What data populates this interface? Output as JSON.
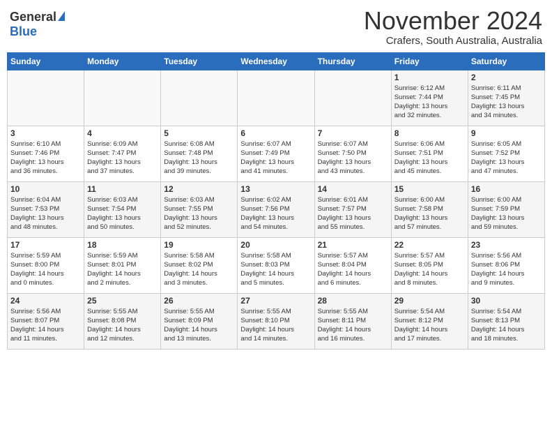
{
  "header": {
    "logo_general": "General",
    "logo_blue": "Blue",
    "month_title": "November 2024",
    "location": "Crafers, South Australia, Australia"
  },
  "weekdays": [
    "Sunday",
    "Monday",
    "Tuesday",
    "Wednesday",
    "Thursday",
    "Friday",
    "Saturday"
  ],
  "weeks": [
    [
      {
        "day": "",
        "info": ""
      },
      {
        "day": "",
        "info": ""
      },
      {
        "day": "",
        "info": ""
      },
      {
        "day": "",
        "info": ""
      },
      {
        "day": "",
        "info": ""
      },
      {
        "day": "1",
        "info": "Sunrise: 6:12 AM\nSunset: 7:44 PM\nDaylight: 13 hours\nand 32 minutes."
      },
      {
        "day": "2",
        "info": "Sunrise: 6:11 AM\nSunset: 7:45 PM\nDaylight: 13 hours\nand 34 minutes."
      }
    ],
    [
      {
        "day": "3",
        "info": "Sunrise: 6:10 AM\nSunset: 7:46 PM\nDaylight: 13 hours\nand 36 minutes."
      },
      {
        "day": "4",
        "info": "Sunrise: 6:09 AM\nSunset: 7:47 PM\nDaylight: 13 hours\nand 37 minutes."
      },
      {
        "day": "5",
        "info": "Sunrise: 6:08 AM\nSunset: 7:48 PM\nDaylight: 13 hours\nand 39 minutes."
      },
      {
        "day": "6",
        "info": "Sunrise: 6:07 AM\nSunset: 7:49 PM\nDaylight: 13 hours\nand 41 minutes."
      },
      {
        "day": "7",
        "info": "Sunrise: 6:07 AM\nSunset: 7:50 PM\nDaylight: 13 hours\nand 43 minutes."
      },
      {
        "day": "8",
        "info": "Sunrise: 6:06 AM\nSunset: 7:51 PM\nDaylight: 13 hours\nand 45 minutes."
      },
      {
        "day": "9",
        "info": "Sunrise: 6:05 AM\nSunset: 7:52 PM\nDaylight: 13 hours\nand 47 minutes."
      }
    ],
    [
      {
        "day": "10",
        "info": "Sunrise: 6:04 AM\nSunset: 7:53 PM\nDaylight: 13 hours\nand 48 minutes."
      },
      {
        "day": "11",
        "info": "Sunrise: 6:03 AM\nSunset: 7:54 PM\nDaylight: 13 hours\nand 50 minutes."
      },
      {
        "day": "12",
        "info": "Sunrise: 6:03 AM\nSunset: 7:55 PM\nDaylight: 13 hours\nand 52 minutes."
      },
      {
        "day": "13",
        "info": "Sunrise: 6:02 AM\nSunset: 7:56 PM\nDaylight: 13 hours\nand 54 minutes."
      },
      {
        "day": "14",
        "info": "Sunrise: 6:01 AM\nSunset: 7:57 PM\nDaylight: 13 hours\nand 55 minutes."
      },
      {
        "day": "15",
        "info": "Sunrise: 6:00 AM\nSunset: 7:58 PM\nDaylight: 13 hours\nand 57 minutes."
      },
      {
        "day": "16",
        "info": "Sunrise: 6:00 AM\nSunset: 7:59 PM\nDaylight: 13 hours\nand 59 minutes."
      }
    ],
    [
      {
        "day": "17",
        "info": "Sunrise: 5:59 AM\nSunset: 8:00 PM\nDaylight: 14 hours\nand 0 minutes."
      },
      {
        "day": "18",
        "info": "Sunrise: 5:59 AM\nSunset: 8:01 PM\nDaylight: 14 hours\nand 2 minutes."
      },
      {
        "day": "19",
        "info": "Sunrise: 5:58 AM\nSunset: 8:02 PM\nDaylight: 14 hours\nand 3 minutes."
      },
      {
        "day": "20",
        "info": "Sunrise: 5:58 AM\nSunset: 8:03 PM\nDaylight: 14 hours\nand 5 minutes."
      },
      {
        "day": "21",
        "info": "Sunrise: 5:57 AM\nSunset: 8:04 PM\nDaylight: 14 hours\nand 6 minutes."
      },
      {
        "day": "22",
        "info": "Sunrise: 5:57 AM\nSunset: 8:05 PM\nDaylight: 14 hours\nand 8 minutes."
      },
      {
        "day": "23",
        "info": "Sunrise: 5:56 AM\nSunset: 8:06 PM\nDaylight: 14 hours\nand 9 minutes."
      }
    ],
    [
      {
        "day": "24",
        "info": "Sunrise: 5:56 AM\nSunset: 8:07 PM\nDaylight: 14 hours\nand 11 minutes."
      },
      {
        "day": "25",
        "info": "Sunrise: 5:55 AM\nSunset: 8:08 PM\nDaylight: 14 hours\nand 12 minutes."
      },
      {
        "day": "26",
        "info": "Sunrise: 5:55 AM\nSunset: 8:09 PM\nDaylight: 14 hours\nand 13 minutes."
      },
      {
        "day": "27",
        "info": "Sunrise: 5:55 AM\nSunset: 8:10 PM\nDaylight: 14 hours\nand 14 minutes."
      },
      {
        "day": "28",
        "info": "Sunrise: 5:55 AM\nSunset: 8:11 PM\nDaylight: 14 hours\nand 16 minutes."
      },
      {
        "day": "29",
        "info": "Sunrise: 5:54 AM\nSunset: 8:12 PM\nDaylight: 14 hours\nand 17 minutes."
      },
      {
        "day": "30",
        "info": "Sunrise: 5:54 AM\nSunset: 8:13 PM\nDaylight: 14 hours\nand 18 minutes."
      }
    ]
  ]
}
